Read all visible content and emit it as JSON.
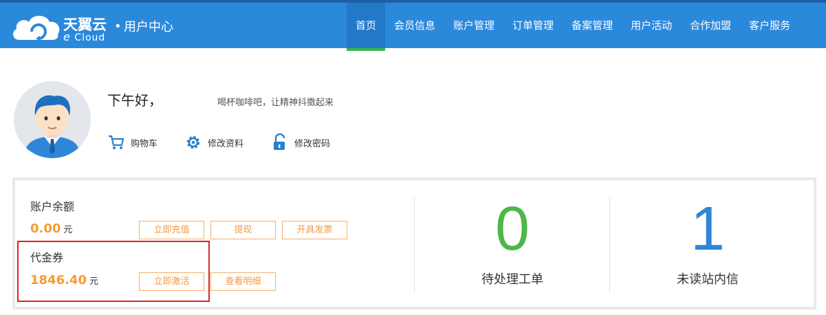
{
  "header": {
    "brand_cn": "天翼云",
    "brand_en_e": "e",
    "brand_en_rest": "Cloud",
    "brand_dot": "•",
    "brand_sub": "用户中心",
    "nav": [
      {
        "label": "首页",
        "active": true
      },
      {
        "label": "会员信息"
      },
      {
        "label": "账户管理"
      },
      {
        "label": "订单管理"
      },
      {
        "label": "备案管理"
      },
      {
        "label": "用户活动"
      },
      {
        "label": "合作加盟"
      },
      {
        "label": "客户服务"
      }
    ]
  },
  "profile": {
    "greeting": "下午好，",
    "slogan": "喝杯咖啡吧，让精神抖擞起来",
    "links": [
      {
        "label": "购物车",
        "icon": "shopping-cart-icon"
      },
      {
        "label": "修改资料",
        "icon": "gear-icon"
      },
      {
        "label": "修改密码",
        "icon": "lock-icon"
      }
    ]
  },
  "account": {
    "balance_label": "账户余额",
    "balance_value": "0.00",
    "balance_unit": "元",
    "recharge_button": "立即充值",
    "withdraw_button": "提现",
    "invoice_button": "开具发票",
    "voucher_label": "代金券",
    "voucher_value": "1846.40",
    "voucher_unit": "元",
    "activate_button": "立即激活",
    "details_button": "查看明细"
  },
  "stats": {
    "pending_tickets_value": "0",
    "pending_tickets_label": "待处理工单",
    "unread_messages_value": "1",
    "unread_messages_label": "未读站内信"
  },
  "colors": {
    "header_bg": "#2b89dc",
    "active_underline": "#3ab54a",
    "accent_orange": "#f59c34",
    "tickets_green": "#4cb849",
    "messages_blue": "#2f86d6",
    "highlight_red": "#e02020"
  }
}
